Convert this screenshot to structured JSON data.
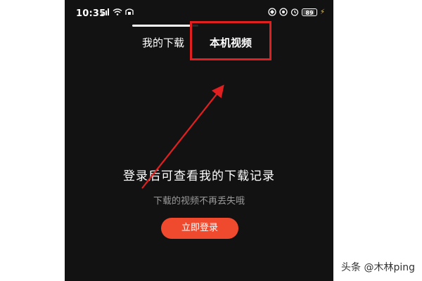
{
  "status_bar": {
    "time": "10:35",
    "left_icons": [
      "signal-icon",
      "wifi-icon",
      "hd-icon"
    ],
    "right_icons": [
      "vpn-icon",
      "location-icon",
      "alarm-icon"
    ],
    "battery": "89",
    "battery_level": 0.89
  },
  "tabs": {
    "progress": 0.9,
    "items": [
      {
        "label": "我的下载"
      },
      {
        "label": "本机视频"
      }
    ]
  },
  "main": {
    "title": "登录后可查看我的下载记录",
    "subtitle": "下载的视频不再丢失哦",
    "login_label": "立即登录"
  },
  "annotations": {
    "highlight_color": "#e02020",
    "arrow_color": "#e02020"
  },
  "watermark": "头条 @木林ping",
  "colors": {
    "background": "#121212",
    "accent": "#f04a2e",
    "subtitle": "#9a9a9a"
  }
}
